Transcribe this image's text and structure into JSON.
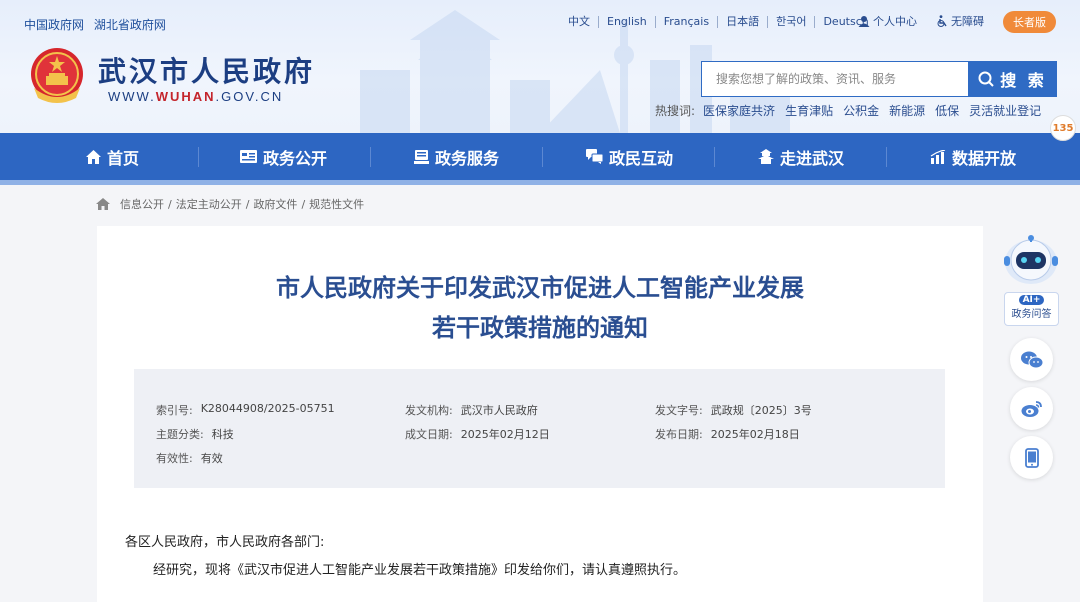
{
  "header": {
    "top_links": [
      "中国政府网",
      "湖北省政府网"
    ],
    "languages": [
      "中文",
      "English",
      "Français",
      "日本語",
      "한국어",
      "Deutsch"
    ],
    "user_center": "个人中心",
    "accessibility": "无障碍",
    "elder_mode": "长者版",
    "site_title": "武汉市人民政府",
    "site_url_prefix": "WWW.",
    "site_url_domain": "WUHAN",
    "site_url_suffix": ".GOV.CN",
    "search_placeholder": "搜索您想了解的政策、资讯、服务",
    "search_button": "搜 索",
    "hot_label": "热搜词:",
    "hot_terms": [
      "医保家庭共济",
      "生育津贴",
      "公积金",
      "新能源",
      "低保",
      "灵活就业登记"
    ],
    "badge": "135"
  },
  "nav": {
    "items": [
      "首页",
      "政务公开",
      "政务服务",
      "政民互动",
      "走进武汉",
      "数据开放"
    ]
  },
  "breadcrumb": [
    "信息公开",
    "法定主动公开",
    "政府文件",
    "规范性文件"
  ],
  "article": {
    "title": "市人民政府关于印发武汉市促进人工智能产业发展若干政策措施的通知",
    "meta": {
      "index_label": "索引号:",
      "index_value": "K28044908/2025-05751",
      "issuer_label": "发文机构:",
      "issuer_value": "武汉市人民政府",
      "docno_label": "发文字号:",
      "docno_value": "武政规〔2025〕3号",
      "category_label": "主题分类:",
      "category_value": "科技",
      "created_label": "成文日期:",
      "created_value": "2025年02月12日",
      "published_label": "发布日期:",
      "published_value": "2025年02月18日",
      "validity_label": "有效性:",
      "validity_value": "有效"
    },
    "addressee": "各区人民政府，市人民政府各部门:",
    "body": "经研究，现将《武汉市促进人工智能产业发展若干政策措施》印发给你们，请认真遵照执行。"
  },
  "sidebar": {
    "ai_tag": "AI+",
    "ai_label": "政务问答"
  },
  "colors": {
    "primary": "#2d66c2",
    "title": "#2a4e91",
    "accent_orange": "#f08a3a",
    "url_red": "#c4242b"
  }
}
